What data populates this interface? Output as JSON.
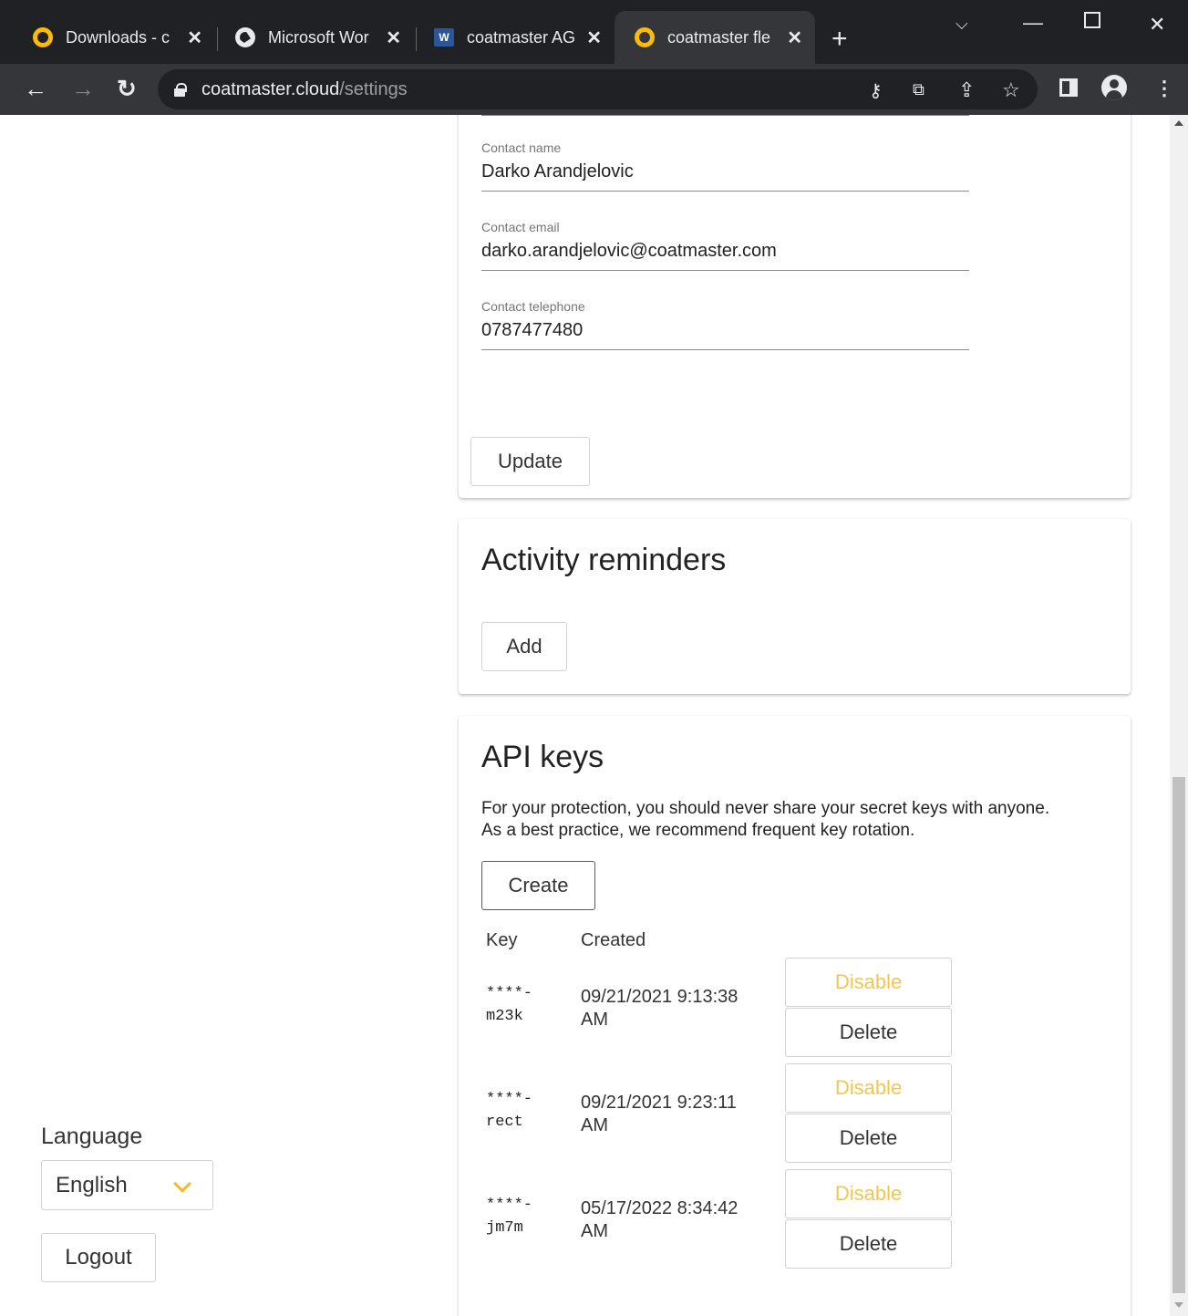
{
  "browser": {
    "tabs": [
      {
        "title": "Downloads - c",
        "icon": "ring-icon"
      },
      {
        "title": "Microsoft Wor",
        "icon": "globe-icon"
      },
      {
        "title": "coatmaster AG",
        "icon": "word-icon",
        "icon_text": "W"
      },
      {
        "title": "coatmaster fle",
        "icon": "ring-icon",
        "active": true
      }
    ],
    "url_host": "coatmaster.cloud",
    "url_path": "/settings"
  },
  "contact": {
    "name_label": "Contact name",
    "name_value": "Darko Arandjelovic",
    "email_label": "Contact email",
    "email_value": "darko.arandjelovic@coatmaster.com",
    "phone_label": "Contact telephone",
    "phone_value": "0787477480",
    "update_label": "Update"
  },
  "reminders": {
    "title": "Activity reminders",
    "add_label": "Add"
  },
  "api_keys": {
    "title": "API keys",
    "description": "For your protection, you should never share your secret keys with anyone. As a best practice, we recommend frequent key rotation.",
    "create_label": "Create",
    "col_key": "Key",
    "col_created": "Created",
    "disable_label": "Disable",
    "delete_label": "Delete",
    "rows": [
      {
        "key_line1": "****-",
        "key_line2": "m23k",
        "created_line1": "09/21/2021 9:13:38",
        "created_line2": "AM"
      },
      {
        "key_line1": "****-",
        "key_line2": "rect",
        "created_line1": "09/21/2021 9:23:11",
        "created_line2": "AM"
      },
      {
        "key_line1": "****-",
        "key_line2": "jm7m",
        "created_line1": "05/17/2022 8:34:42",
        "created_line2": "AM"
      }
    ]
  },
  "sidebar": {
    "language_label": "Language",
    "language_value": "English",
    "logout_label": "Logout"
  },
  "colors": {
    "accent": "#f4bb2a",
    "disable_text": "#f4c64c",
    "chrome_dark": "#202124",
    "chrome_toolbar": "#35363a"
  }
}
